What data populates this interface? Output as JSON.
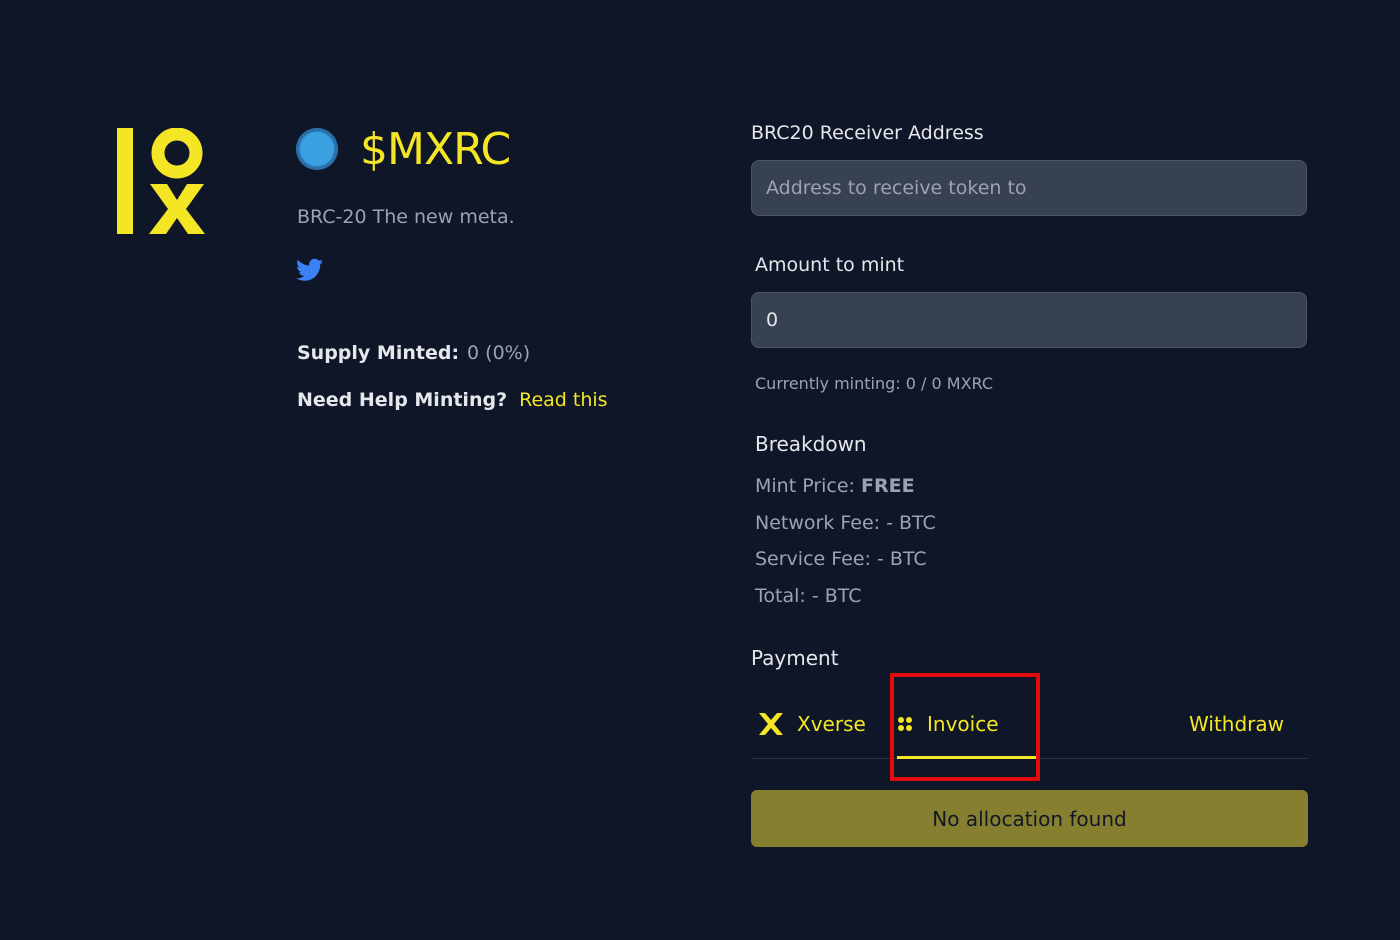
{
  "colors": {
    "background": "#0f1628",
    "accent": "#f5e625",
    "input_bg": "#374151",
    "button_bg": "#857f2f",
    "highlight": "#e00b0b",
    "twitter": "#3b82f6"
  },
  "logo": {
    "icon": "iox-logo"
  },
  "token": {
    "name": "$MXRC",
    "description": "BRC-20 The new meta.",
    "icon": "token-coin-icon",
    "social_icon": "twitter-icon"
  },
  "supply": {
    "label": "Supply Minted:",
    "value": "0 (0%)"
  },
  "help": {
    "label": "Need Help Minting?",
    "link": "Read this"
  },
  "form": {
    "receiver_label": "BRC20 Receiver Address",
    "receiver_placeholder": "Address to receive token to",
    "receiver_value": "",
    "amount_label": "Amount to mint",
    "amount_value": "0",
    "minting_note": "Currently minting: 0 / 0 MXRC"
  },
  "breakdown": {
    "title": "Breakdown",
    "mint_price_label": "Mint Price:",
    "mint_price_value": "FREE",
    "network_fee": "Network Fee: - BTC",
    "service_fee": "Service Fee: - BTC",
    "total": "Total: - BTC"
  },
  "payment": {
    "title": "Payment",
    "tabs": [
      {
        "label": "Xverse",
        "icon": "xverse-icon"
      },
      {
        "label": "Invoice",
        "icon": "grid-dots-icon",
        "active": true
      },
      {
        "label": "Withdraw"
      }
    ],
    "status_button": "No allocation found"
  }
}
